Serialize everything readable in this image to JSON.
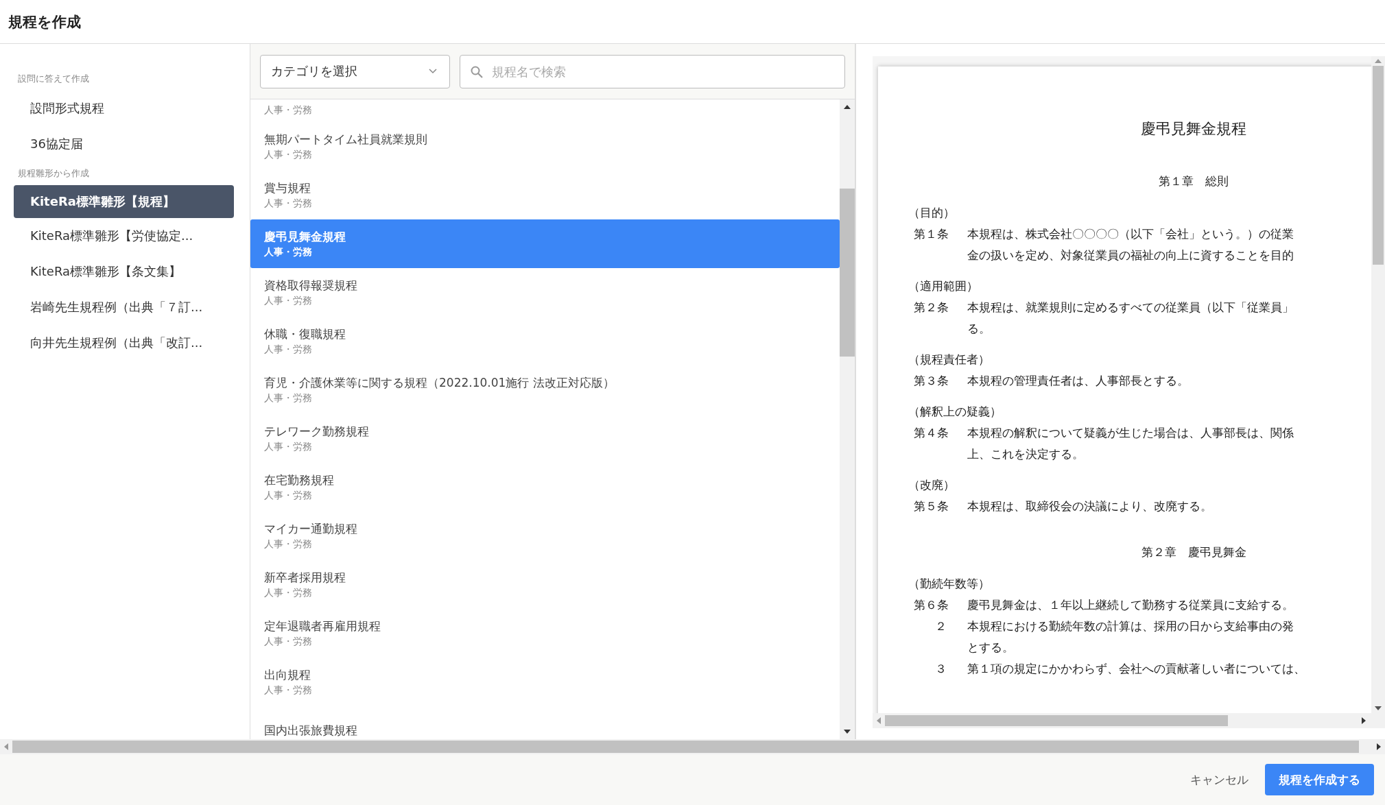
{
  "dialog": {
    "title": "規程を作成"
  },
  "sidebar": {
    "sections": [
      {
        "heading": "設問に答えて作成",
        "items": [
          {
            "label": "設問形式規程",
            "selected": false
          },
          {
            "label": "36協定届",
            "selected": false
          }
        ]
      },
      {
        "heading": "規程雛形から作成",
        "items": [
          {
            "label": "KiteRa標準雛形【規程】",
            "selected": true
          },
          {
            "label": "KiteRa標準雛形【労使協定...",
            "selected": false
          },
          {
            "label": "KiteRa標準雛形【条文集】",
            "selected": false
          },
          {
            "label": "岩崎先生規程例（出典「７訂...",
            "selected": false
          },
          {
            "label": "向井先生規程例（出典「改訂...",
            "selected": false
          }
        ]
      }
    ]
  },
  "filters": {
    "category": {
      "value": "カテゴリを選択"
    },
    "search": {
      "placeholder": "規程名で検索"
    }
  },
  "templates": [
    {
      "category": "人事・労務",
      "selected": false
    },
    {
      "name": "無期パートタイム社員就業規則",
      "category": "人事・労務",
      "selected": false
    },
    {
      "name": "賞与規程",
      "category": "人事・労務",
      "selected": false
    },
    {
      "name": "慶弔見舞金規程",
      "category": "人事・労務",
      "selected": true
    },
    {
      "name": "資格取得報奨規程",
      "category": "人事・労務",
      "selected": false
    },
    {
      "name": "休職・復職規程",
      "category": "人事・労務",
      "selected": false
    },
    {
      "name": "育児・介護休業等に関する規程（2022.10.01施行 法改正対応版）",
      "category": "人事・労務",
      "selected": false
    },
    {
      "name": "テレワーク勤務規程",
      "category": "人事・労務",
      "selected": false
    },
    {
      "name": "在宅勤務規程",
      "category": "人事・労務",
      "selected": false
    },
    {
      "name": "マイカー通勤規程",
      "category": "人事・労務",
      "selected": false
    },
    {
      "name": "新卒者採用規程",
      "category": "人事・労務",
      "selected": false
    },
    {
      "name": "定年退職者再雇用規程",
      "category": "人事・労務",
      "selected": false
    },
    {
      "name": "出向規程",
      "category": "人事・労務",
      "selected": false
    },
    {
      "name": "国内出張旅費規程",
      "selected": false
    }
  ],
  "preview": {
    "title": "慶弔見舞金規程",
    "blocks": [
      {
        "kind": "chapter",
        "text": "第１章　総則"
      },
      {
        "kind": "heading",
        "text": "（目的）"
      },
      {
        "kind": "article",
        "number": "第１条",
        "lines": [
          "本規程は、株式会社〇〇〇〇（以下「会社」という。）の従業",
          "金の扱いを定め、対象従業員の福祉の向上に資することを目的"
        ]
      },
      {
        "kind": "heading",
        "text": "（適用範囲）"
      },
      {
        "kind": "article",
        "number": "第２条",
        "lines": [
          "本規程は、就業規則に定めるすべての従業員（以下「従業員」",
          "る。"
        ]
      },
      {
        "kind": "heading",
        "text": "（規程責任者）"
      },
      {
        "kind": "article",
        "number": "第３条",
        "lines": [
          "本規程の管理責任者は、人事部長とする。"
        ]
      },
      {
        "kind": "heading",
        "text": "（解釈上の疑義）"
      },
      {
        "kind": "article",
        "number": "第４条",
        "lines": [
          "本規程の解釈について疑義が生じた場合は、人事部長は、関係",
          "上、これを決定する。"
        ]
      },
      {
        "kind": "heading",
        "text": "（改廃）"
      },
      {
        "kind": "article",
        "number": "第５条",
        "lines": [
          "本規程は、取締役会の決議により、改廃する。"
        ]
      },
      {
        "kind": "chapter",
        "text": "第２章　慶弔見舞金"
      },
      {
        "kind": "heading",
        "text": "（勤続年数等）"
      },
      {
        "kind": "article",
        "number": "第６条",
        "lines": [
          "慶弔見舞金は、１年以上継続して勤務する従業員に支給する。"
        ]
      },
      {
        "kind": "paragraph",
        "number": "２",
        "lines": [
          "本規程における勤続年数の計算は、採用の日から支給事由の発",
          "とする。"
        ]
      },
      {
        "kind": "paragraph",
        "number": "３",
        "lines": [
          "第１項の規定にかかわらず、会社への貢献著しい者については、"
        ]
      }
    ]
  },
  "footer": {
    "cancel": "キャンセル",
    "submit": "規程を作成する"
  }
}
